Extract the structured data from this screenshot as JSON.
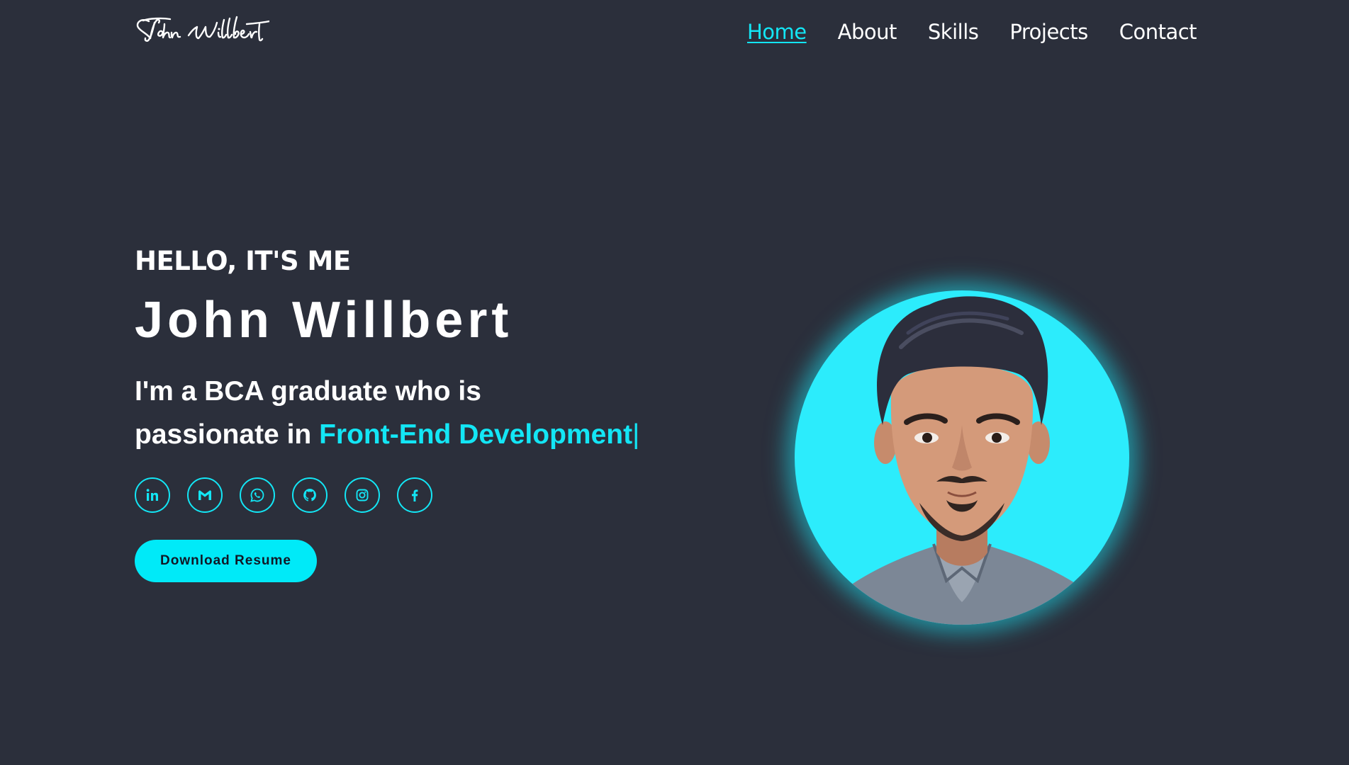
{
  "header": {
    "logo_text": "John Willbert",
    "nav": [
      {
        "label": "Home",
        "active": true
      },
      {
        "label": "About",
        "active": false
      },
      {
        "label": "Skills",
        "active": false
      },
      {
        "label": "Projects",
        "active": false
      },
      {
        "label": "Contact",
        "active": false
      }
    ]
  },
  "hero": {
    "greeting": "HELLO, IT'S ME",
    "name": "John Willbert",
    "tagline_line1": "I'm a BCA graduate who is",
    "tagline_prefix": "passionate in",
    "typed_text": "Front-End Development",
    "caret": "|",
    "socials": [
      {
        "icon": "linkedin-icon"
      },
      {
        "icon": "gmail-icon"
      },
      {
        "icon": "whatsapp-icon"
      },
      {
        "icon": "github-icon"
      },
      {
        "icon": "instagram-icon"
      },
      {
        "icon": "facebook-icon"
      }
    ],
    "cta_label": "Download Resume"
  },
  "colors": {
    "background": "#2b2f3b",
    "accent": "#13e6f5",
    "button": "#00eaf8",
    "text": "#ffffff"
  }
}
